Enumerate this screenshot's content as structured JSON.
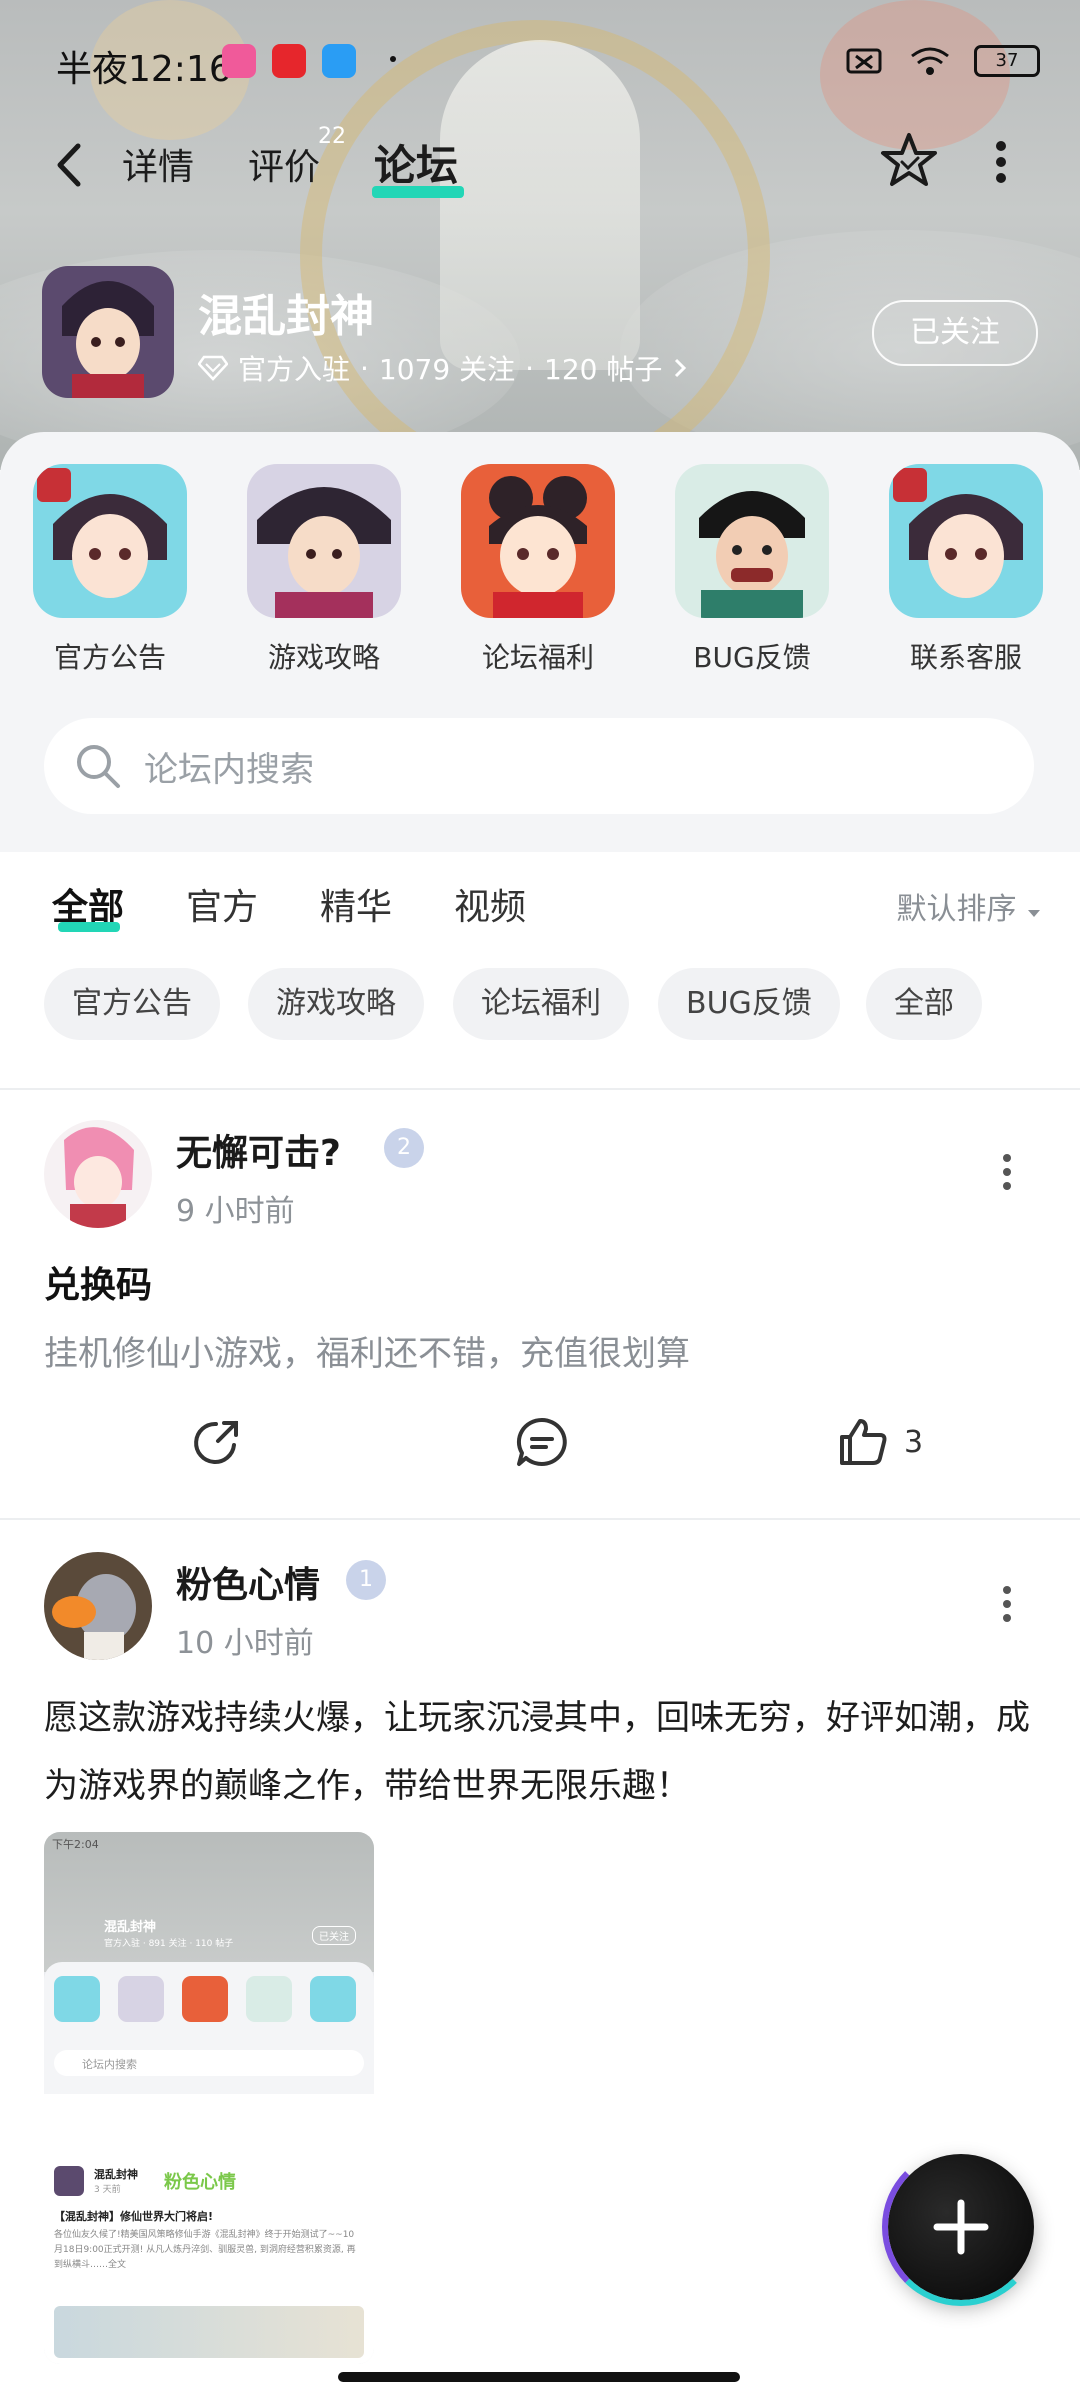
{
  "status_bar": {
    "time": "半夜12:16",
    "battery": "37"
  },
  "nav": {
    "back_label": "<",
    "tabs": [
      "详情",
      "评价",
      "论坛"
    ],
    "review_count": "22",
    "active_tab": "论坛"
  },
  "game": {
    "name": "混乱封神",
    "official": "官方入驻",
    "followers": "1079 关注",
    "posts": "120 帖子",
    "separator": "·",
    "follow_label": "已关注"
  },
  "categories": [
    "官方公告",
    "游戏攻略",
    "论坛福利",
    "BUG反馈",
    "联系客服"
  ],
  "search": {
    "placeholder": "论坛内搜索"
  },
  "feed_tabs": [
    "全部",
    "官方",
    "精华",
    "视频"
  ],
  "sort_label": "默认排序",
  "chips": [
    "官方公告",
    "游戏攻略",
    "论坛福利",
    "BUG反馈",
    "全部"
  ],
  "posts": [
    {
      "author": "无懈可击?",
      "level": "2",
      "time": "9 小时前",
      "title": "兑换码",
      "body": "挂机修仙小游戏，福利还不错，充值很划算",
      "likes": "3"
    },
    {
      "author": "粉色心情",
      "level": "1",
      "time": "10 小时前",
      "body": "愿这款游戏持续火爆，让玩家沉浸其中，回味无穷，好评如潮，成为游戏界的巅峰之作，带给世界无限乐趣！",
      "screenshot": {
        "time": "下午2:04",
        "game": "混乱封神",
        "meta": "官方入驻 · 891 关注 · 110 帖子",
        "follow": "已关注",
        "search": "论坛内搜索",
        "post_author": "混乱封神",
        "post_time": "3 天前",
        "overlay": "粉色心情",
        "post_title": "【混乱封神】修仙世界大门将启!",
        "post_body": "各位仙友久候了!精美国风策略修仙手游《混乱封神》终于开始测试了~~10月18日9:00正式开测! 从凡人炼丹淬剑、驯服灵兽, 到洞府经营积累资源, 再到纵横斗……全文"
      }
    }
  ],
  "colors": {
    "accent": "#22d6b6",
    "muted": "#8a8f95"
  }
}
